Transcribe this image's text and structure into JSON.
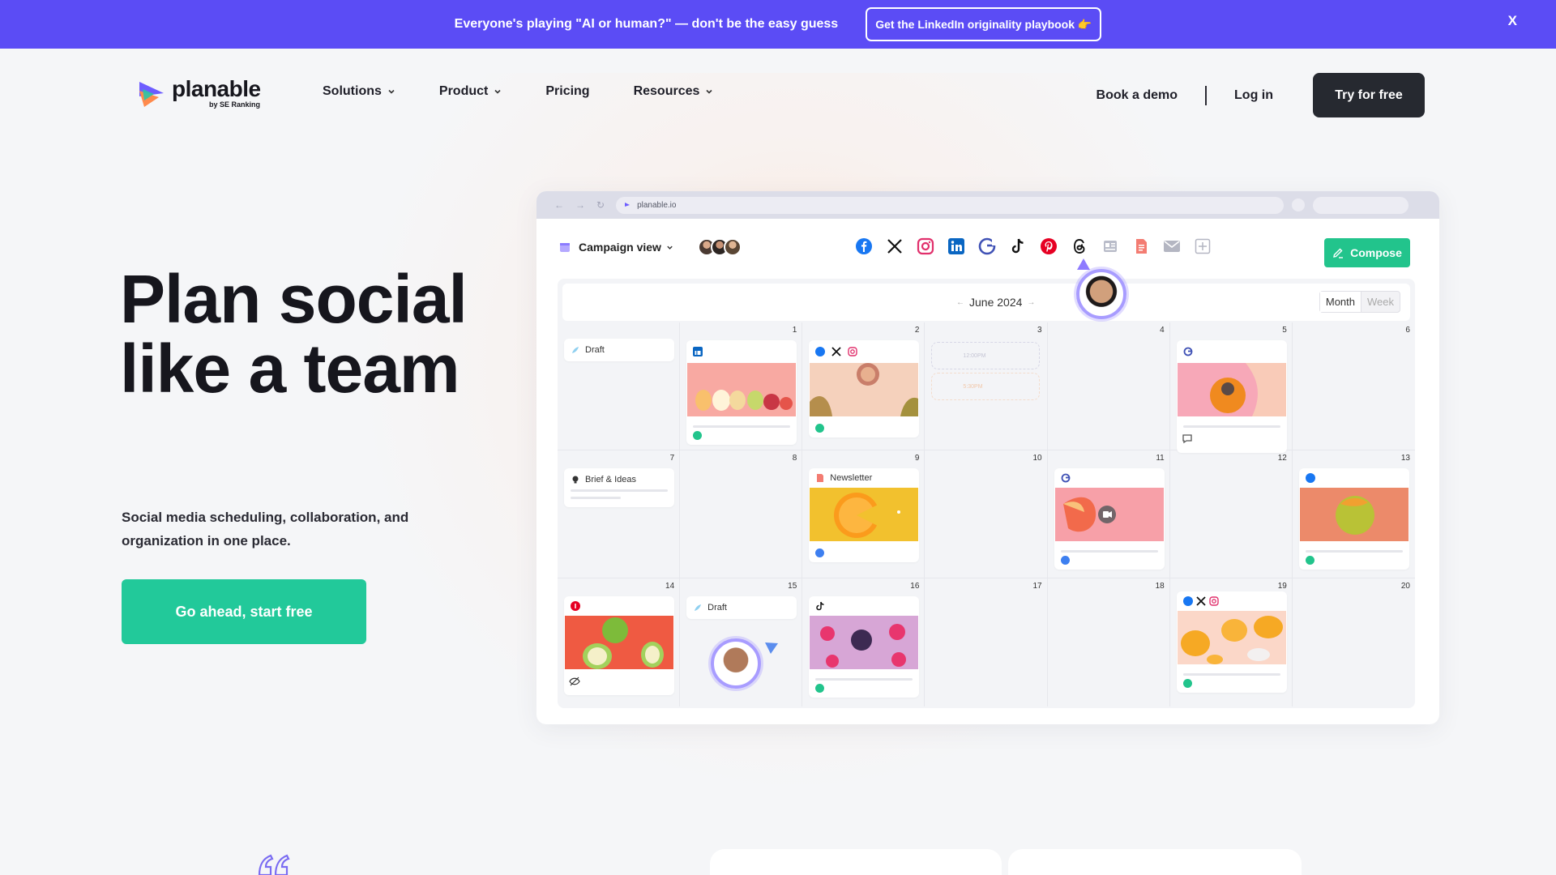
{
  "announcement": {
    "text": "Everyone's playing \"AI or human?\" — don't be the easy guess",
    "button_label": "Get the LinkedIn originality playbook 👉",
    "close_label": "X"
  },
  "header": {
    "logo_text": "planable",
    "logo_sub": "by SE Ranking",
    "nav": [
      {
        "label": "Solutions",
        "has_dropdown": true
      },
      {
        "label": "Product",
        "has_dropdown": true
      },
      {
        "label": "Pricing",
        "has_dropdown": false
      },
      {
        "label": "Resources",
        "has_dropdown": true
      }
    ],
    "book_demo": "Book a demo",
    "login": "Log in",
    "try_free": "Try for free"
  },
  "hero": {
    "title": "Plan social like a team",
    "subtitle": "Social media scheduling, collaboration, and organization in one place.",
    "cta": "Go ahead, start free"
  },
  "app": {
    "url": "planable.io",
    "view_label": "Campaign view",
    "networks": [
      "facebook-icon",
      "x-icon",
      "instagram-icon",
      "linkedin-icon",
      "google-business-icon",
      "tiktok-icon",
      "pinterest-icon",
      "threads-icon",
      "blog-icon",
      "document-icon",
      "email-icon",
      "add-icon"
    ],
    "compose_label": "Compose",
    "month_label": "June 2024",
    "view_toggle": {
      "month": "Month",
      "week": "Week"
    },
    "days": [
      {
        "num": "",
        "type": "tag",
        "label": "Draft"
      },
      {
        "num": "1",
        "type": "post",
        "networks": [
          "linkedin"
        ],
        "status": "approved"
      },
      {
        "num": "2",
        "type": "post",
        "networks": [
          "facebook",
          "x",
          "instagram"
        ],
        "status": "approved"
      },
      {
        "num": "3",
        "type": "slots",
        "slots": [
          "12:00PM",
          "5:30PM"
        ]
      },
      {
        "num": "4",
        "type": "empty"
      },
      {
        "num": "5",
        "type": "post",
        "networks": [
          "google"
        ],
        "status": "comment"
      },
      {
        "num": "6",
        "type": "empty"
      },
      {
        "num": "7",
        "type": "tag",
        "label": "Brief & Ideas"
      },
      {
        "num": "8",
        "type": "empty"
      },
      {
        "num": "9",
        "type": "post",
        "label": "Newsletter",
        "status": "scheduled"
      },
      {
        "num": "10",
        "type": "empty"
      },
      {
        "num": "11",
        "type": "post",
        "networks": [
          "google"
        ],
        "status": "scheduled"
      },
      {
        "num": "12",
        "type": "empty"
      },
      {
        "num": "13",
        "type": "post",
        "networks": [
          "facebook"
        ],
        "status": "approved"
      },
      {
        "num": "14",
        "type": "post",
        "networks": [
          "pinterest"
        ],
        "status": "hidden"
      },
      {
        "num": "15",
        "type": "tag",
        "label": "Draft"
      },
      {
        "num": "16",
        "type": "post",
        "networks": [
          "tiktok"
        ],
        "status": "approved"
      },
      {
        "num": "17",
        "type": "empty"
      },
      {
        "num": "18",
        "type": "empty"
      },
      {
        "num": "19",
        "type": "post",
        "networks": [
          "facebook",
          "x",
          "instagram"
        ],
        "status": "approved"
      },
      {
        "num": "20",
        "type": "empty"
      }
    ]
  },
  "colors": {
    "announce_bg": "#5b4cf5",
    "cta_green": "#22c99a",
    "compose_green": "#22c48c",
    "dark_button": "#262930",
    "presence_ring": "#a89cff"
  }
}
